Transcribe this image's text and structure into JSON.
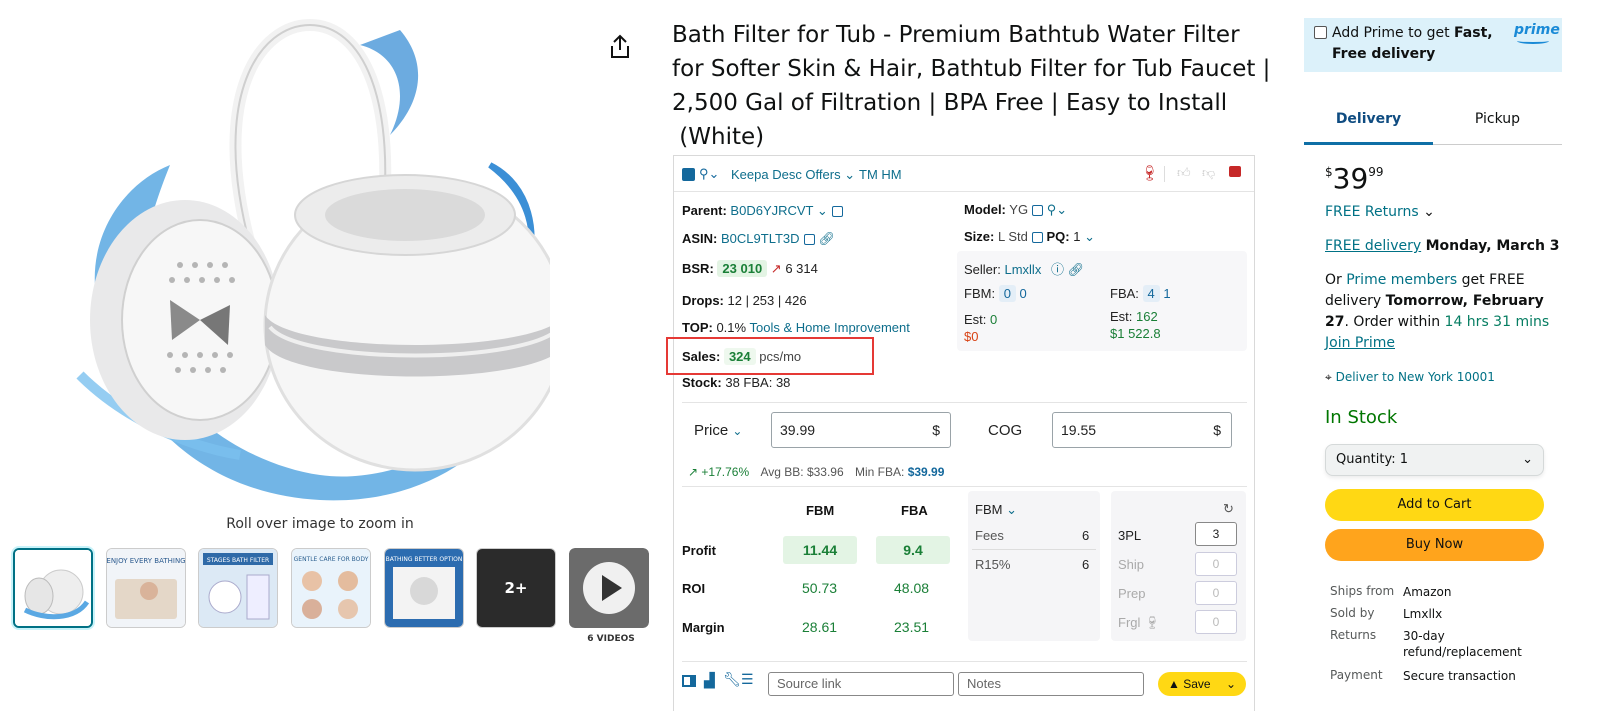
{
  "colors": {
    "link": "#007185",
    "green": "#1a7f37",
    "prime_bg": "#dcf1fa",
    "cart_btn": "#ffd814",
    "buy_btn": "#ffa41c",
    "highlight_box": "#e53935"
  },
  "gallery": {
    "zoom_hint": "Roll over image to zoom in",
    "more_label": "2+",
    "videos_label": "6 VIDEOS",
    "thumb_texts": [
      "ENJOY EVERY BATHING",
      "STAGES BATH FILTER",
      "GENTLE CARE FOR BODY",
      "BATHING BETTER OPTION"
    ]
  },
  "product": {
    "title_lines": [
      "Bath Filter for Tub - Premium Bathtub Water Filter",
      "for Softer Skin & Hair, Bathtub Filter for Tub Faucet |",
      "2,500 Gal of Filtration | BPA Free | Easy to Install",
      " (White)"
    ]
  },
  "keepa": {
    "toolbar": {
      "desc": "Keepa Desc Offers",
      "tm": "TM HM"
    },
    "parent_label": "Parent:",
    "parent_value": "B0D6YJRCVT",
    "asin_label": "ASIN:",
    "asin_value": "B0CL9TLT3D",
    "bsr_label": "BSR:",
    "bsr_value": "23 010",
    "bsr_change": "6 314",
    "drops_label": "Drops:",
    "drops_value": "12 | 253 | 426",
    "top_label": "TOP:",
    "top_value": "0.1%",
    "top_category": "Tools & Home Improvement",
    "sales_label": "Sales:",
    "sales_value": "324",
    "sales_unit": "pcs/mo",
    "stock_label": "Stock:",
    "stock_value": "38 FBA: 38",
    "model_label": "Model:",
    "model_value": "YG",
    "size_label": "Size:",
    "size_value": "L Std",
    "pq_label": "PQ:",
    "pq_value": "1",
    "seller_label": "Seller:",
    "seller_value": "Lmxllx",
    "fbm_label": "FBM:",
    "fbm_a": "0",
    "fbm_b": "0",
    "fba_label": "FBA:",
    "fba_a": "4",
    "fba_b": "1",
    "est_label": "Est:",
    "est_fbm": "0",
    "est_fbm_money": "$0",
    "est_fba": "162",
    "est_fba_money": "$1 522.8",
    "price_label": "Price",
    "price_value": "39.99",
    "cog_label": "COG",
    "cog_value": "19.55",
    "currency": "$",
    "trend": "+17.76%",
    "avg_bb": "Avg BB: $33.96",
    "min_fba_label": "Min FBA: ",
    "min_fba_value": "$39.99",
    "table": {
      "col_fbm": "FBM",
      "col_fba": "FBA",
      "rows": [
        {
          "label": "Profit",
          "fbm": "11.44",
          "fba": "9.4"
        },
        {
          "label": "ROI",
          "fbm": "50.73",
          "fba": "48.08"
        },
        {
          "label": "Margin",
          "fbm": "28.61",
          "fba": "23.51"
        }
      ]
    },
    "fees": {
      "mode": "FBM",
      "fees_label": "Fees",
      "fees_value": "6",
      "r15_label": "R15%",
      "r15_value": "6"
    },
    "logistics": {
      "pl_label": "3PL",
      "pl_value": "3",
      "ship_label": "Ship",
      "ship_value": "0",
      "prep_label": "Prep",
      "prep_value": "0",
      "frgl_label": "Frgl",
      "frgl_value": "0"
    },
    "bottom": {
      "source_placeholder": "Source link",
      "notes_placeholder": "Notes",
      "save_label": "Save"
    }
  },
  "buybox": {
    "prime_text_a": "Add Prime to get ",
    "prime_text_b": "Fast,",
    "prime_text_c": "Free delivery",
    "prime_logo": "prime",
    "tab_delivery": "Delivery",
    "tab_pickup": "Pickup",
    "price_symbol": "$",
    "price_whole": "39",
    "price_fraction": "99",
    "free_returns": "FREE Returns",
    "free_delivery": "FREE delivery",
    "delivery_date": "Monday, March 3",
    "or_text": "Or ",
    "prime_members": "Prime members",
    "get_free": " get FREE",
    "delivery_line": "delivery ",
    "tomorrow": "Tomorrow, February",
    "day": "27",
    "order_within": ". Order within ",
    "countdown": "14 hrs 31 mins",
    "join_prime": "Join Prime",
    "deliver_to": "Deliver to New York 10001",
    "stock": "In Stock",
    "quantity": "Quantity: 1",
    "add_to_cart": "Add to Cart",
    "buy_now": "Buy Now",
    "ships_from_label": "Ships from",
    "ships_from": "Amazon",
    "sold_by_label": "Sold by",
    "sold_by": "Lmxllx",
    "returns_label": "Returns",
    "returns_a": "30-day",
    "returns_b": "refund/replacement",
    "payment_label": "Payment",
    "payment": "Secure transaction"
  }
}
